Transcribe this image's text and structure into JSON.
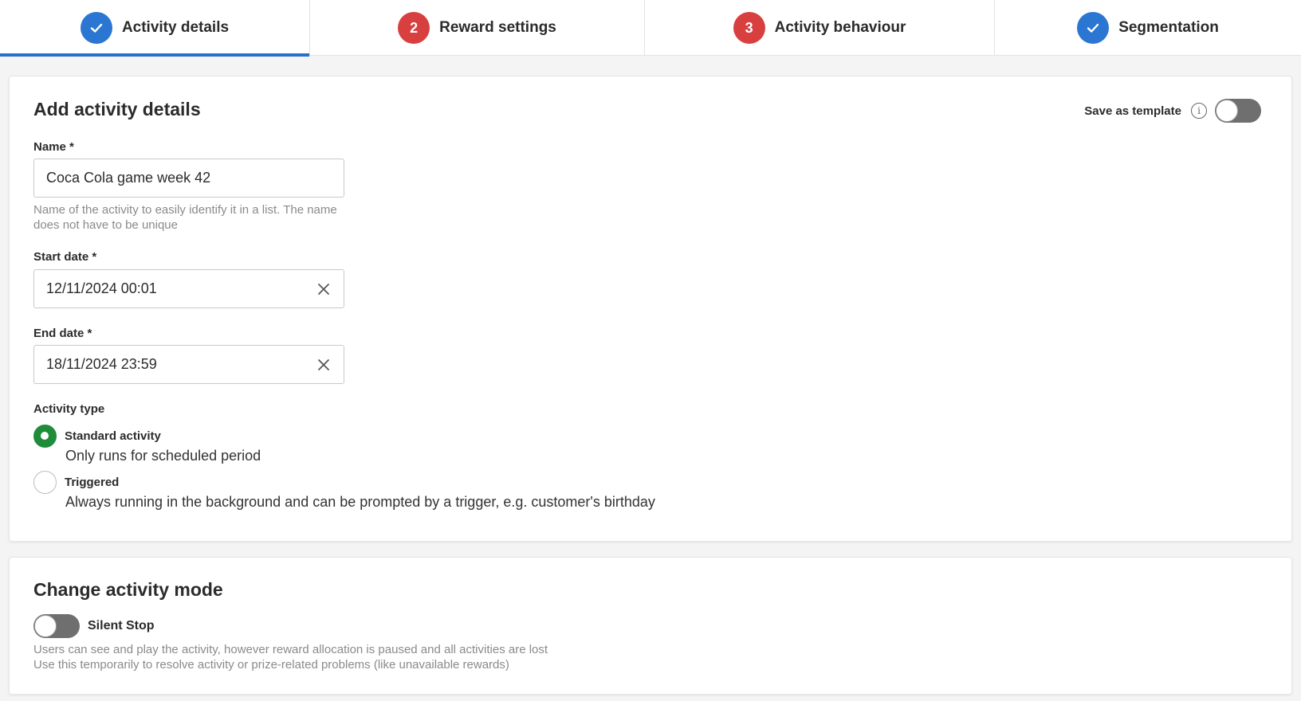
{
  "stepper": {
    "steps": [
      {
        "label": "Activity details",
        "badge": "",
        "status": "done",
        "active": true
      },
      {
        "label": "Reward settings",
        "badge": "2",
        "status": "error",
        "active": false
      },
      {
        "label": "Activity behaviour",
        "badge": "3",
        "status": "error",
        "active": false
      },
      {
        "label": "Segmentation",
        "badge": "",
        "status": "done",
        "active": false
      }
    ]
  },
  "details_card": {
    "title": "Add activity details",
    "save_template_label": "Save as template",
    "save_template_enabled": false,
    "name": {
      "label": "Name *",
      "value": "Coca Cola game week 42",
      "help": "Name of the activity to easily identify it in a list. The name does not have to be unique"
    },
    "start_date": {
      "label": "Start date *",
      "value": "12/11/2024 00:01"
    },
    "end_date": {
      "label": "End date *",
      "value": "18/11/2024 23:59"
    },
    "activity_type": {
      "label": "Activity type",
      "options": [
        {
          "label": "Standard activity",
          "description": "Only runs for scheduled period",
          "checked": true
        },
        {
          "label": "Triggered",
          "description": "Always running in the background and can be prompted by a trigger, e.g. customer's birthday",
          "checked": false
        }
      ]
    }
  },
  "mode_card": {
    "title": "Change activity mode",
    "silent_stop_label": "Silent Stop",
    "silent_stop_enabled": false,
    "help_line1": "Users can see and play the activity, however reward allocation is paused and all activities are lost",
    "help_line2": "Use this temporarily to resolve activity or prize-related problems (like unavailable rewards)"
  },
  "colors": {
    "accent": "#2a6fc9",
    "done_badge": "#2a76d2",
    "error_badge": "#d84040",
    "radio_checked": "#1f8c3a"
  }
}
